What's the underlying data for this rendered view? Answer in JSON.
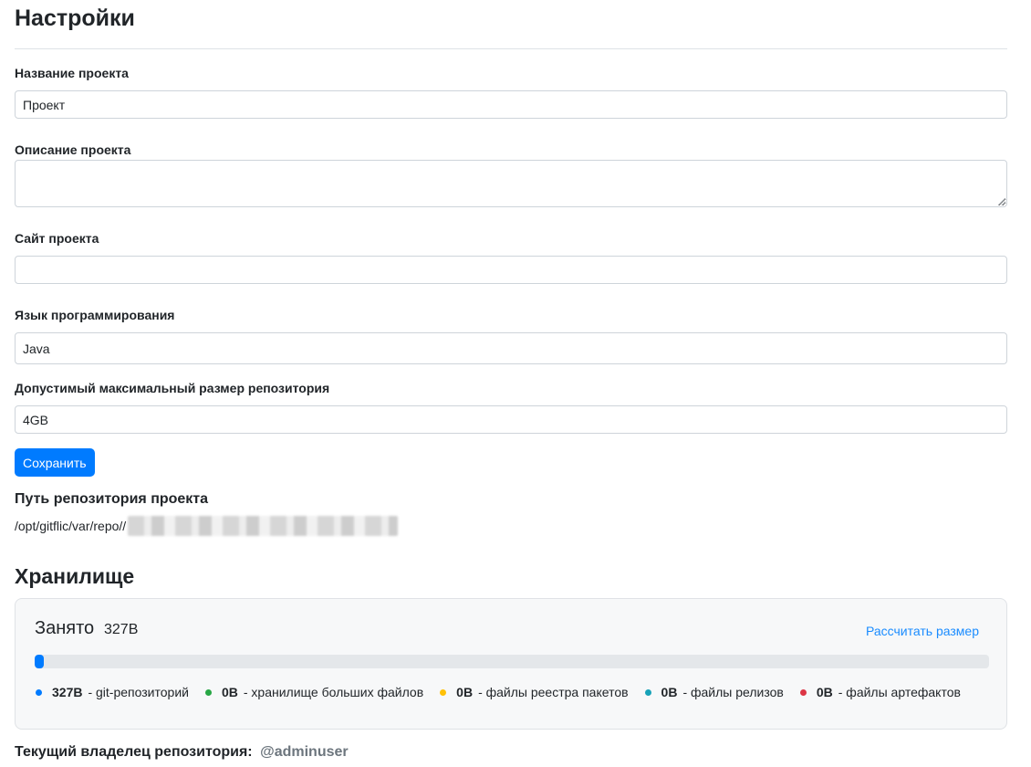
{
  "page": {
    "title": "Настройки"
  },
  "form": {
    "name": {
      "label": "Название проекта",
      "value": "Проект"
    },
    "description": {
      "label": "Описание проекта",
      "value": ""
    },
    "site": {
      "label": "Сайт проекта",
      "value": ""
    },
    "language": {
      "label": "Язык программирования",
      "value": "Java"
    },
    "max_size": {
      "label": "Допустимый максимальный размер репозитория",
      "value": "4GB"
    },
    "save_label": "Сохранить"
  },
  "repo_path": {
    "title": "Путь репозитория проекта",
    "prefix": "/opt/gitflic/var/repo//"
  },
  "storage": {
    "title": "Хранилище",
    "used_label": "Занято",
    "used_value": "327B",
    "calc_label": "Рассчитать размер",
    "progress_percent": 1,
    "legend": [
      {
        "value": "327B",
        "label": "- git-репозиторий",
        "color": "#007bff"
      },
      {
        "value": "0B",
        "label": "- хранилище больших файлов",
        "color": "#28a745"
      },
      {
        "value": "0B",
        "label": "- файлы реестра пакетов",
        "color": "#ffc107"
      },
      {
        "value": "0B",
        "label": "- файлы релизов",
        "color": "#17a2b8"
      },
      {
        "value": "0B",
        "label": "- файлы артефактов",
        "color": "#dc3545"
      }
    ]
  },
  "owner": {
    "label": "Текущий владелец репозитория:",
    "user": "@adminuser"
  }
}
